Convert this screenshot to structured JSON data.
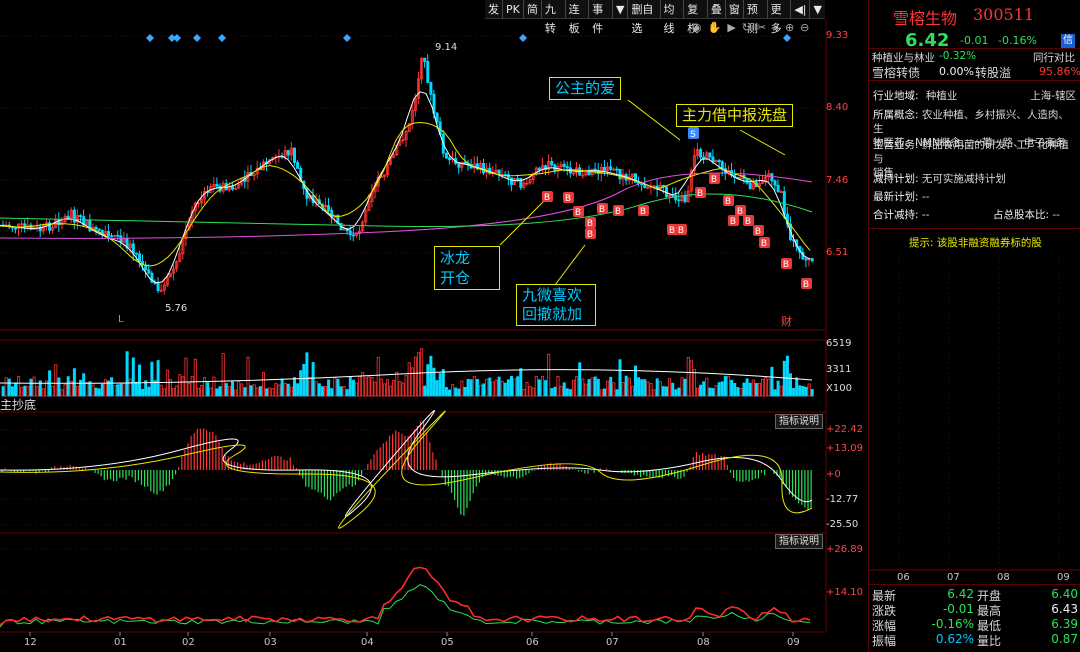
{
  "toolbar": {
    "items": [
      "发",
      "PK",
      "简",
      "九转",
      "连板",
      "事件",
      "▼",
      "删自选",
      "均线",
      "复权",
      "叠",
      "窗",
      "预测",
      "更多",
      "◀|",
      "▼"
    ]
  },
  "chart": {
    "high_label": "9.14",
    "low_label": "5.76",
    "price_axis": [
      "9.33",
      "8.40",
      "7.46",
      "6.51"
    ],
    "volume_axis": [
      "6519",
      "3311",
      "X100"
    ],
    "macd_axis": [
      "+22.42",
      "+13.09",
      "+0",
      "-12.77",
      "-25.50"
    ],
    "ind2_axis": [
      "+26.89",
      "+14.10"
    ],
    "indicator_btn": "指标说明",
    "indicator2_btn": "指标说明",
    "indicator_name": "主抄底",
    "marker_L": "L",
    "marker_cai": "财",
    "marker_S": "S",
    "marker_B": "B",
    "months": [
      "12",
      "01",
      "02",
      "03",
      "04",
      "05",
      "06",
      "07",
      "08",
      "09"
    ]
  },
  "annotations": {
    "gongzhu": "公主的爱",
    "zhuli": "主力借中报洗盘",
    "binglong_1": "冰龙",
    "binglong_2": "开仓",
    "jiuwei_1": "九微喜欢",
    "jiuwei_2": "回撤就加"
  },
  "quote": {
    "name": "雪榕生物",
    "code": "300511",
    "price": "6.42",
    "change": "-0.01",
    "change_pct": "-0.16%",
    "credit_badge": "信",
    "sector_name": "种植业与林业",
    "sector_pct": "-0.32%",
    "compare_label": "同行对比",
    "bond_name": "雪榕转债",
    "bond_pct": "0.00%",
    "premium_label": "转股溢",
    "premium_val": "95.86%"
  },
  "info": {
    "industry_label": "行业地域:",
    "industry_val": "种植业",
    "region_val": "上海-辖区",
    "concept_label": "所属概念:",
    "concept_val_1": "农业种植、乡村振兴、人造肉、生",
    "concept_val_2": "物医药、NMN概念、一带一路、电子商务",
    "business_label": "主营业务:",
    "business_val_1": "鲜品食用菌的研发、工厂化种植与",
    "business_val_2": "销售。",
    "reduce_label": "减持计划:",
    "reduce_val": "无可实施减持计划",
    "latest_plan_label": "最新计划:",
    "latest_plan_val": "--",
    "total_reduce_label": "合计减持:",
    "total_reduce_val": "--",
    "share_ratio_label": "占总股本比:",
    "share_ratio_val": "--",
    "tip": "提示: 该股非融资融券标的股"
  },
  "minichart_months": [
    "06",
    "07",
    "08",
    "09"
  ],
  "quotes": {
    "latest_k": "最新",
    "latest_v": "6.42",
    "open_k": "开盘",
    "open_v": "6.40",
    "chg_k": "涨跌",
    "chg_v": "-0.01",
    "high_k": "最高",
    "high_v": "6.43",
    "chgpct_k": "涨幅",
    "chgpct_v": "-0.16%",
    "low_k": "最低",
    "low_v": "6.39",
    "amp_k": "振幅",
    "amp_v": "0.62%",
    "volr_k": "量比",
    "volr_v": "0.87"
  },
  "colors": {
    "up": "#ff3434",
    "down": "#00d8ff",
    "accent": "#e8e800",
    "border": "#5a0000"
  }
}
